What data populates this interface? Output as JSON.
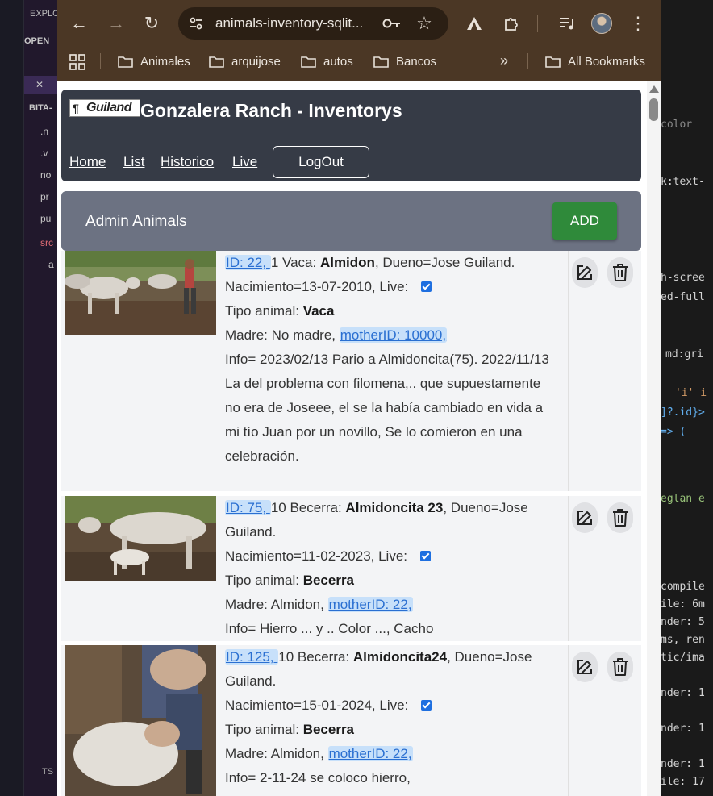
{
  "vscode": {
    "explorer_label": "EXPLO",
    "open_label": "OPEN",
    "project_label": "BITA-",
    "tree": [
      ".n",
      ".v",
      "no",
      "pr",
      "pu",
      "src",
      "a"
    ],
    "code_lines": [
      {
        "text": "color"
      },
      {
        "text": "k:text-"
      },
      {
        "text": "h-scree"
      },
      {
        "text": "ed-full"
      },
      {
        "text": "md:gri"
      },
      {
        "text": "'i' i"
      },
      {
        "text": "]?.id}>"
      },
      {
        "text": "=> ("
      },
      {
        "text": "eglan e"
      },
      {
        "text": "compile"
      },
      {
        "text": "ile: 6m"
      },
      {
        "text": "nder: 5"
      },
      {
        "text": "ms, ren"
      },
      {
        "text": "tic/ima"
      },
      {
        "text": "nder: 1"
      },
      {
        "text": "nder: 1"
      },
      {
        "text": "nder: 1"
      },
      {
        "text": "ile: 17"
      }
    ]
  },
  "browser": {
    "url": "animals-inventory-sqlit...",
    "bookmarks": [
      "Animales",
      "arquijose",
      "autos",
      "Bancos"
    ],
    "all_bookmarks": "All Bookmarks"
  },
  "site": {
    "logo_text": "Guiland",
    "title": "Gonzalera Ranch - Inventorys",
    "nav": [
      "Home",
      "List",
      "Historico",
      "Live"
    ],
    "logout": "LogOut",
    "admin_title": "Admin Animals",
    "add_label": "ADD"
  },
  "animals": [
    {
      "id_link": "ID:  22, ",
      "after_id": "1  Vaca:  ",
      "name": "Almidon",
      "owner": ",   Dueno=Jose Guiland.",
      "birth": "Nacimiento=13-07-2010, Live:",
      "type_label": "Tipo animal: ",
      "type": "Vaca",
      "mother_prefix": "Madre: No madre, ",
      "mother_link": "motherID:  10000,",
      "info": "Info= 2023/02/13 Pario a Almidoncita(75). 2022/11/13 La del problema con filomena,.. que supuestamente no era de Joseee, el se la había cambiado en vida a mi tío Juan por un novillo, Se lo comieron en una celebración.",
      "live": true
    },
    {
      "id_link": "ID:  75, ",
      "after_id": "10  Becerra:  ",
      "name": "Almidoncita 23",
      "owner": ", Dueno=Jose Guiland.",
      "birth": "Nacimiento=11-02-2023, Live:",
      "type_label": "Tipo animal: ",
      "type": "Becerra",
      "mother_prefix": "Madre: Almidon, ",
      "mother_link": "motherID:  22,",
      "info": "Info= Hierro ... y .. Color ..., Cacho",
      "live": true
    },
    {
      "id_link": "ID:  125, ",
      "after_id": "10  Becerra:  ",
      "name": "Almidoncita24",
      "owner": ", Dueno=Jose Guiland.",
      "birth": "Nacimiento=15-01-2024, Live:",
      "type_label": "Tipo animal: ",
      "type": "Becerra",
      "mother_prefix": "Madre: Almidon, ",
      "mother_link": "motherID:  22,",
      "info": "Info= 2-11-24 se coloco hierro,",
      "live": true
    }
  ]
}
